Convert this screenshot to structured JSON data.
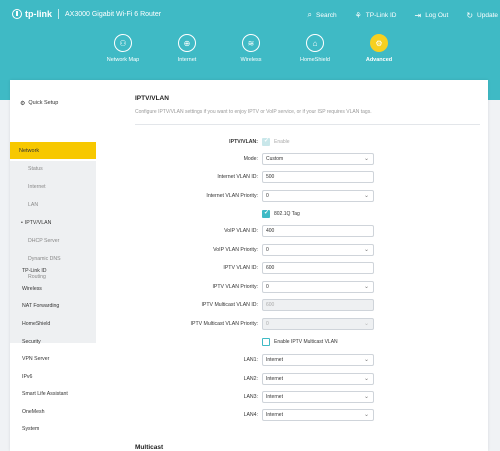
{
  "header": {
    "brand": "tp-link",
    "router_name": "AX3000 Gigabit Wi-Fi 6 Router",
    "links": [
      {
        "label": "Search",
        "icon": "search-icon",
        "glyph": "⌕"
      },
      {
        "label": "TP-Link ID",
        "icon": "person-icon",
        "glyph": "⚘"
      },
      {
        "label": "Log Out",
        "icon": "logout-icon",
        "glyph": "⇥"
      },
      {
        "label": "Update",
        "icon": "update-icon",
        "glyph": "↻"
      }
    ],
    "accent": "#3fbac5"
  },
  "nav": {
    "items": [
      {
        "label": "Network Map",
        "icon": "network-map-icon",
        "glyph": "⚇"
      },
      {
        "label": "Internet",
        "icon": "globe-icon",
        "glyph": "⊕"
      },
      {
        "label": "Wireless",
        "icon": "wifi-icon",
        "glyph": "≋"
      },
      {
        "label": "HomeShield",
        "icon": "shield-icon",
        "glyph": "⌂"
      },
      {
        "label": "Advanced",
        "icon": "gear-icon",
        "glyph": "⚙"
      }
    ],
    "active": "Advanced",
    "active_color": "#f7d020"
  },
  "sidebar": {
    "quick_setup": "Quick Setup",
    "network": "Network",
    "network_sub": [
      "Status",
      "Internet",
      "LAN",
      "IPTV/VLAN",
      "DHCP Server",
      "Dynamic DNS",
      "Routing"
    ],
    "current_sub": "IPTV/VLAN",
    "items": [
      "TP-Link ID",
      "Wireless",
      "NAT Forwarding",
      "HomeShield",
      "Security",
      "VPN Server",
      "IPv6",
      "Smart Life Assistant",
      "OneMesh",
      "System"
    ]
  },
  "content": {
    "title": "IPTV/VLAN",
    "description": "Configure IPTV/VLAN settings if you want to enjoy IPTV or VoIP service, or if your ISP requires VLAN tags.",
    "iptv_vlan_label": "IPTV/VLAN:",
    "enable_label": "Enable",
    "mode_label": "Mode:",
    "mode_value": "Custom",
    "internet_vlan_id_label": "Internet VLAN ID:",
    "internet_vlan_id": "500",
    "internet_vlan_priority_label": "Internet VLAN Priority:",
    "internet_vlan_priority": "0",
    "tag_label": "802.1Q Tag",
    "voip_vlan_id_label": "VoIP VLAN ID:",
    "voip_vlan_id": "400",
    "voip_vlan_priority_label": "VoIP VLAN Priority:",
    "voip_vlan_priority": "0",
    "iptv_vlan_id_label": "IPTV VLAN ID:",
    "iptv_vlan_id": "600",
    "iptv_vlan_priority_label": "IPTV VLAN Priority:",
    "iptv_vlan_priority": "0",
    "multicast_vlan_id_label": "IPTV Multicast VLAN ID:",
    "multicast_vlan_id": "600",
    "multicast_vlan_priority_label": "IPTV Multicast VLAN Priority:",
    "multicast_vlan_priority": "0",
    "enable_multicast_label": "Enable IPTV Multicast VLAN",
    "lan1_label": "LAN1:",
    "lan1_value": "Internet",
    "lan2_label": "LAN2:",
    "lan2_value": "Internet",
    "lan3_label": "LAN3:",
    "lan3_value": "Internet",
    "lan4_label": "LAN4:",
    "lan4_value": "Internet",
    "multicast_title": "Multicast"
  }
}
